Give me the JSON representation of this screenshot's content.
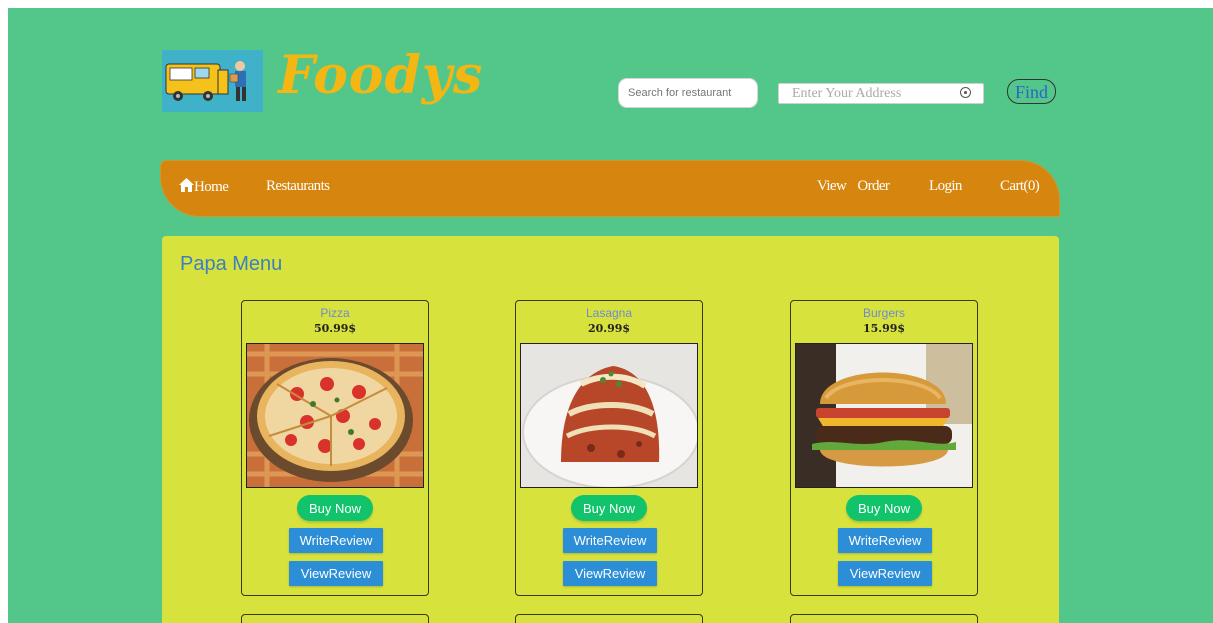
{
  "brand": {
    "name": "Foodys"
  },
  "header": {
    "search_placeholder": "Search for restaurant",
    "address_placeholder": "Enter Your Address",
    "find_label": "Find"
  },
  "nav": {
    "home": "Home",
    "restaurants": "Restaurants",
    "view_order": "View Order",
    "login": "Login",
    "cart": "Cart(0)"
  },
  "menu": {
    "title": "Papa Menu",
    "items": [
      {
        "name": "Pizza",
        "price": "50.99$",
        "buy_label": "Buy Now",
        "write_review_label": "WriteReview",
        "view_review_label": "ViewReview"
      },
      {
        "name": "Lasagna",
        "price": "20.99$",
        "buy_label": "Buy Now",
        "write_review_label": "WriteReview",
        "view_review_label": "ViewReview"
      },
      {
        "name": "Burgers",
        "price": "15.99$",
        "buy_label": "Buy Now",
        "write_review_label": "WriteReview",
        "view_review_label": "ViewReview"
      }
    ]
  },
  "colors": {
    "page_background": "#53c68a",
    "nav_background": "#d6850f",
    "content_background": "#d8e23d",
    "buy_button": "#11c46c",
    "review_button": "#2b8ed6",
    "brand_text": "#f3b612"
  }
}
